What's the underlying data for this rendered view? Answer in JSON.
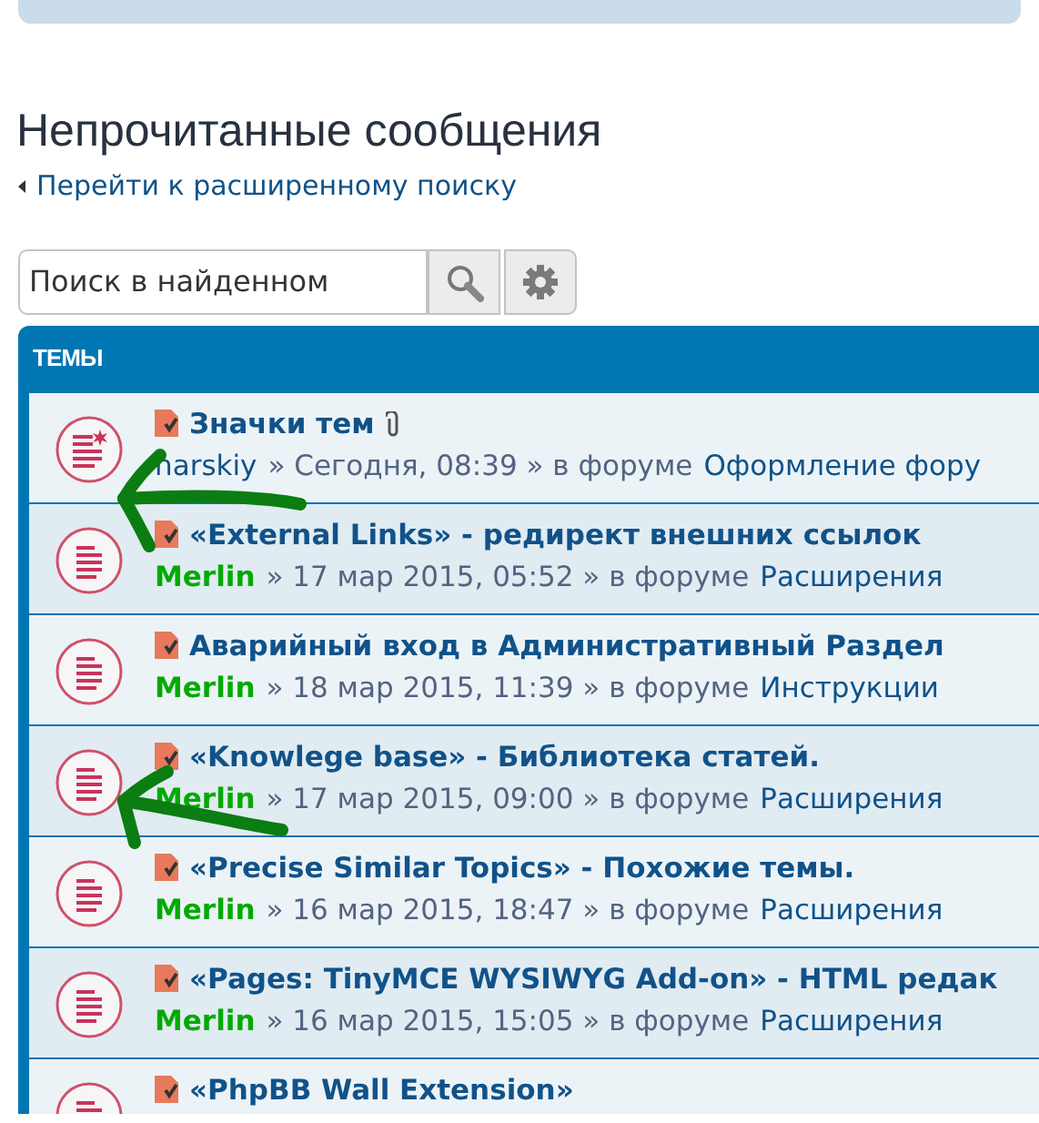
{
  "page_title": "Непрочитанные сообщения",
  "advanced_search_link": "Перейти к расширенному поиску",
  "search": {
    "placeholder": "Поиск в найденном"
  },
  "panel": {
    "header": "ТЕМЫ"
  },
  "topics": [
    {
      "title": "Значки тем",
      "attachment": true,
      "unread_marker": true,
      "author": "harskiy",
      "color": "#105289",
      "meta": "» Сегодня, 08:39 » в форуме",
      "forum": "Оформление фору"
    },
    {
      "title": "«External Links» - редирект внешних ссылок",
      "attachment": false,
      "unread_marker": false,
      "author": "Merlin",
      "color": "#00aa00",
      "meta": "» 17 мар 2015, 05:52 » в форуме",
      "forum": "Расширения"
    },
    {
      "title": "Аварийный вход в Административный Раздел",
      "attachment": false,
      "unread_marker": false,
      "author": "Merlin",
      "color": "#00aa00",
      "meta": "» 18 мар 2015, 11:39 » в форуме",
      "forum": "Инструкции"
    },
    {
      "title": "«Knowlege base» - Библиотека статей.",
      "attachment": false,
      "unread_marker": false,
      "author": "Merlin",
      "color": "#00aa00",
      "meta": "» 17 мар 2015, 09:00 » в форуме",
      "forum": "Расширения"
    },
    {
      "title": "«Precise Similar Topics» - Похожие темы.",
      "attachment": false,
      "unread_marker": false,
      "author": "Merlin",
      "color": "#00aa00",
      "meta": "» 16 мар 2015, 18:47 » в форуме",
      "forum": "Расширения"
    },
    {
      "title": "«Pages: TinyMCE WYSIWYG Add-on» - HTML редак",
      "attachment": false,
      "unread_marker": false,
      "author": "Merlin",
      "color": "#00aa00",
      "meta": "» 16 мар 2015, 15:05 » в форуме",
      "forum": "Расширения"
    },
    {
      "title": "«PhpBB Wall Extension»",
      "attachment": false,
      "unread_marker": false
    }
  ],
  "annotations": [
    {
      "kind": "arrow"
    },
    {
      "kind": "arrow"
    }
  ]
}
